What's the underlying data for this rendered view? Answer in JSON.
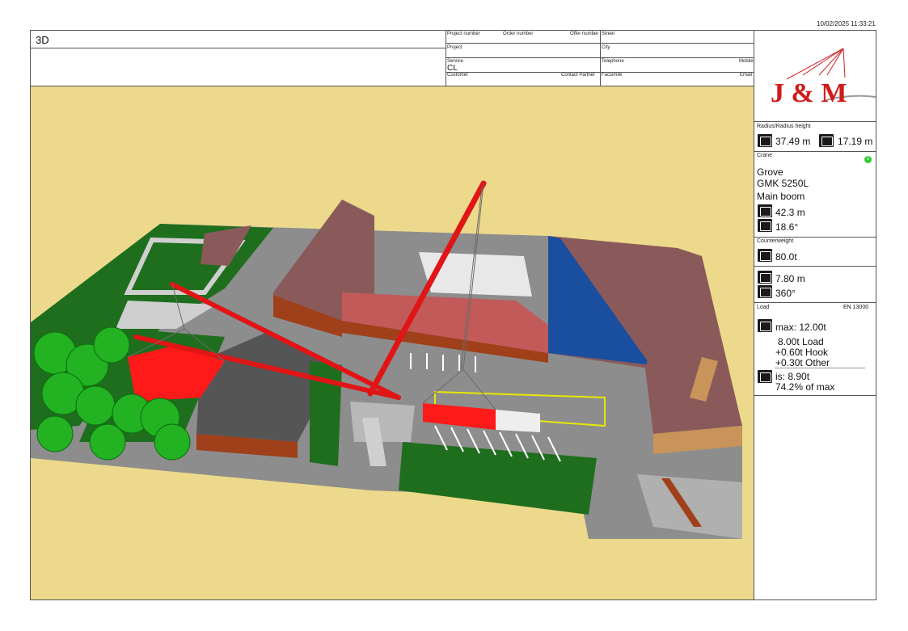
{
  "timestamp": "10/02/2025 11:33:21",
  "view_title": "3D",
  "header": {
    "project_number_label": "Project number",
    "order_number_label": "Order number",
    "offer_number_label": "Offer number",
    "street_label": "Street",
    "project_label": "Project",
    "city_label": "City",
    "service_label": "Service",
    "service_value": "CL",
    "telephone_label": "Telephone",
    "mobile_label": "Mobile",
    "customer_label": "Customer",
    "contact_partner_label": "Contact Partner",
    "facsimile_label": "Facsimile",
    "email_label": "Email"
  },
  "logo": {
    "text": "J & M",
    "color": "#d11a1a"
  },
  "radius": {
    "label": "Radius/Radius height",
    "radius_value": "37.49 m",
    "height_value": "17.19 m"
  },
  "crane": {
    "label": "Crane",
    "badge": "1",
    "make": "Grove",
    "model": "GMK 5250L",
    "boom_label": "Main boom",
    "boom_length": "42.3 m",
    "boom_angle": "18.6°"
  },
  "counterweight": {
    "label": "Counterweight",
    "value": "80.0t"
  },
  "outrigger": {
    "spread": "7.80 m",
    "slew": "360°"
  },
  "load": {
    "label": "Load",
    "standard": "EN 13000",
    "max": "max: 12.00t",
    "load_line": "8.00t Load",
    "hook_line": "+0.60t Hook",
    "other_line": "+0.30t Other",
    "is_line": "is: 8.90t",
    "pct_line": "74.2% of max"
  },
  "colors": {
    "ground": "#ecd98b",
    "grass": "#1e6e1e",
    "asphalt": "#8d8d8d",
    "roof_brown": "#8a5a5a",
    "boom_red": "#e01515",
    "trailer_red": "#ff1a1a",
    "tree_green": "#22b222",
    "shed_blue": "#1a4fa0"
  }
}
